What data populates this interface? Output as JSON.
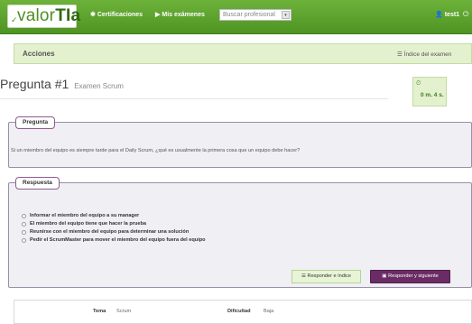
{
  "navbar": {
    "logo": {
      "prefix": "valor",
      "suffix": "TIa"
    },
    "certificaciones": "Certificaciones",
    "mis_examenes": "Mis exámenes",
    "search_placeholder": "Buscar profesional",
    "user": "test1"
  },
  "acciones": {
    "title": "Acciones",
    "indice": "Índice del examen"
  },
  "question": {
    "title": "Pregunta #1",
    "subtitle": "Examen Scrum",
    "timer": "0 m. 4 s.",
    "legend": "Pregunta",
    "text": "Si un miembro del equipo es siempre tarde para el Daily Scrum, ¿qué es usualmente la primera cosa que un equipo debe hacer?"
  },
  "answer": {
    "legend": "Respuesta",
    "options": [
      "Informar el miembro del equipo a su manager",
      "El miembro del equipo tiene que hacer la prueba",
      "Reunirse con el miembro del equipo para determinar una solución",
      "Pedir el ScrumMaster para mover el miembro del equipo fuera del equipo"
    ],
    "btn_indice": "Responder e índice",
    "btn_siguiente": "Responder y siguiente"
  },
  "meta": {
    "tema_label": "Tema",
    "tema_value": "Scrum",
    "dificultad_label": "Dificultad",
    "dificultad_value": "Baja"
  }
}
